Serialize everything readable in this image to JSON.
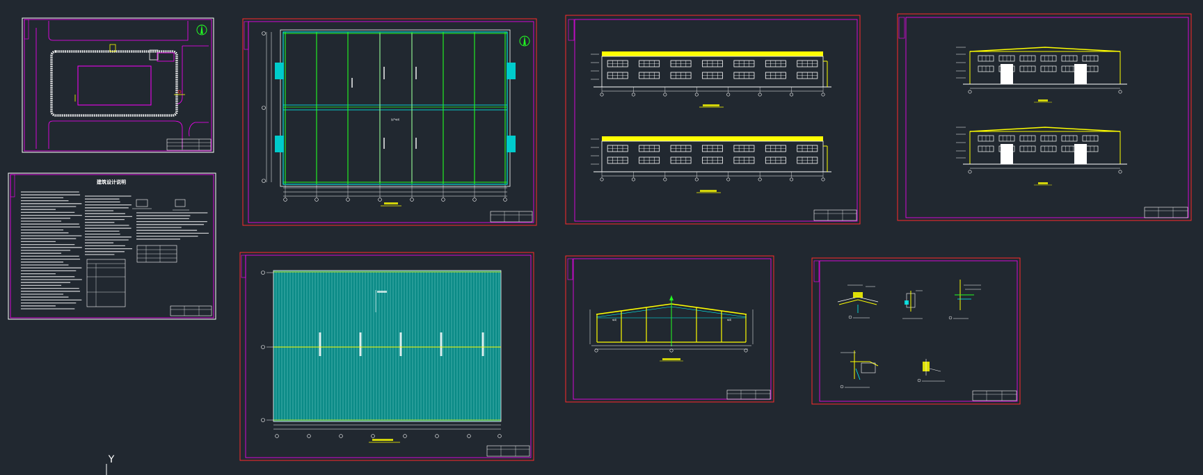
{
  "app": "CAD model space - industrial building drawing set",
  "colors": {
    "background": "#212830",
    "sheet_border_outer": "#ff2a2a",
    "sheet_border_inner": "#ff00ff",
    "wall_yellow": "#ffff00",
    "grid_green": "#22ff22",
    "cyan": "#00ffff",
    "white": "#ffffff",
    "teal_roof": "#0a8a86"
  },
  "icons": {
    "north_arrow": "north-arrow-icon",
    "ucs": "ucs-axis-icon"
  },
  "ucs": {
    "y_label": "Y"
  },
  "sheets": {
    "notes": {
      "title": "建筑设计说明"
    },
    "floor_plan": {
      "room_label": "生产车间"
    },
    "section": {
      "room_labels": [
        "车间",
        "车间"
      ]
    }
  }
}
